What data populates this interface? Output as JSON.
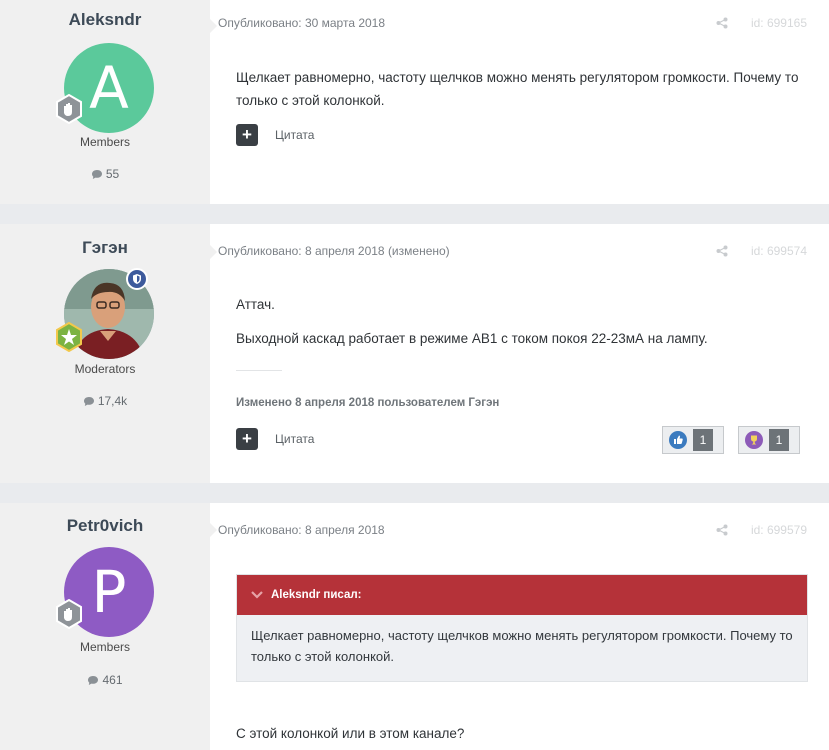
{
  "posts": [
    {
      "author": "Aleksndr",
      "avatar_letter": "A",
      "avatar_color": "#5bc99b",
      "group": "Members",
      "post_count": "55",
      "published": "Опубликовано: 30 марта 2018",
      "id": "id: 699165",
      "paragraphs": [
        "Щелкает равномерно, частоту щелчков можно менять регулятором громкости. Почему то только с этой колонкой."
      ],
      "quote_label": "Цитата"
    },
    {
      "author": "Гэгэн",
      "group": "Moderators",
      "post_count": "17,4k",
      "published": "Опубликовано: 8 апреля 2018 (изменено)",
      "id": "id: 699574",
      "paragraphs": [
        "Аттач.",
        "Выходной каскад работает в режиме AB1 с током покоя 22-23мА на лампу."
      ],
      "edited_note": "Изменено 8 апреля 2018 пользователем Гэгэн",
      "quote_label": "Цитата",
      "reactions": [
        {
          "icon": "like-icon",
          "count": "1",
          "color": "#3b7bbf"
        },
        {
          "icon": "trophy-icon",
          "count": "1",
          "color": "#8d5bb8"
        }
      ]
    },
    {
      "author": "Petr0vich",
      "avatar_letter": "P",
      "avatar_color": "#8e5bc4",
      "group": "Members",
      "post_count": "461",
      "published": "Опубликовано: 8 апреля 2018",
      "id": "id: 699579",
      "quote_block": {
        "header": "Aleksndr писал:",
        "text": "Щелкает равномерно, частоту щелчков можно менять регулятором громкости. Почему то только с этой колонкой."
      },
      "paragraphs": [
        "С этой колонкой или в этом канале?"
      ]
    }
  ]
}
